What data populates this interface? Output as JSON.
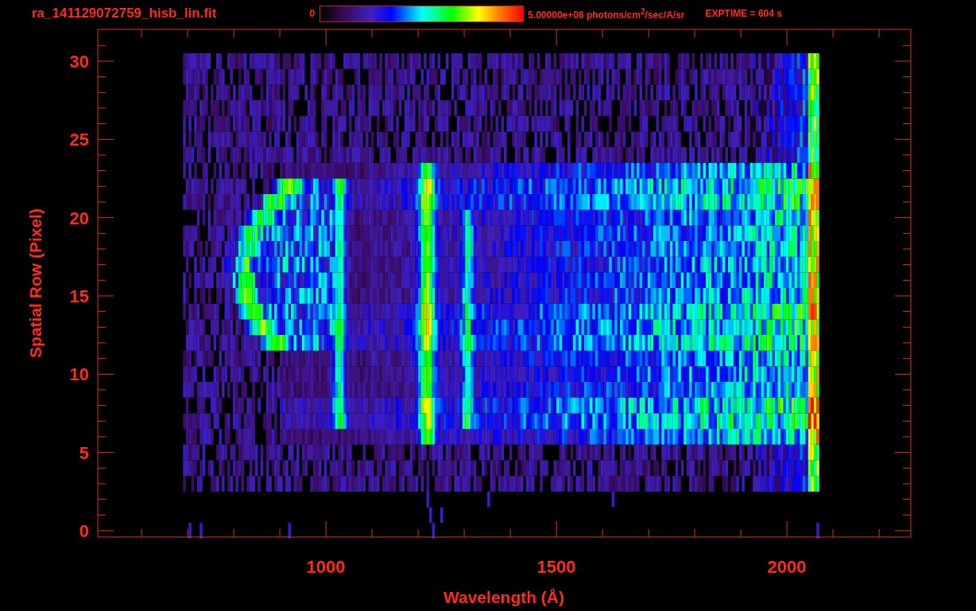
{
  "header": {
    "file_name": "ra_141129072759_hisb_lin.fit",
    "colorbar": {
      "min_label": "0",
      "max_label": "5.00000e+06 photons/cm$^{2}$/sec/A/sr"
    },
    "exposure": "EXPTIME = 604 s"
  },
  "plot": {
    "x_axis": {
      "title": "Wavelength (Å)",
      "ticks": [
        "1000",
        "1500",
        "2000"
      ]
    },
    "y_axis": {
      "title": "Spatial Row (Pixel)",
      "ticks": [
        "30",
        "25",
        "20",
        "15",
        "10",
        "5",
        "0"
      ]
    }
  }
}
